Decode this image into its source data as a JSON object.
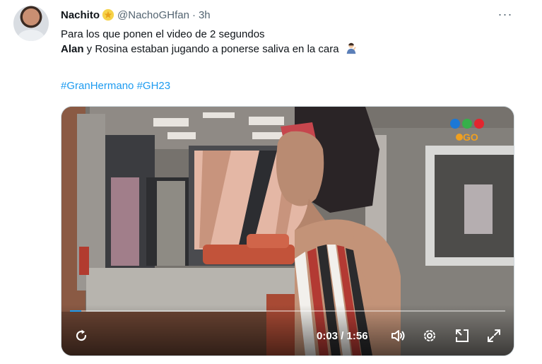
{
  "tweet": {
    "author_name": "Nachito",
    "handle": "@NachoGHfan",
    "separator": "·",
    "time": "3h",
    "more_label": "···",
    "lines": [
      {
        "bold": "",
        "text": "Para los que ponen el video de 2 segundos"
      },
      {
        "bold": "Alan",
        "text": " y Rosina estaban jugando a ponerse saliva en la cara"
      }
    ],
    "hashtags": [
      "#GranHermano",
      "#GH23"
    ]
  },
  "video": {
    "elapsed": "0:03",
    "divider": " / ",
    "duration": "1:56",
    "progress_fraction": 0.026,
    "channel_logo_text": "GO"
  },
  "colors": {
    "link": "#1d9bf0",
    "text": "#0f1419",
    "secondary": "#536471"
  },
  "icons": [
    "avatar",
    "star-badge-icon",
    "person-gesturing-emoji-icon",
    "more-icon",
    "replay-icon",
    "volume-icon",
    "settings-icon",
    "picture-in-picture-icon",
    "fullscreen-icon",
    "telefe-logo"
  ]
}
